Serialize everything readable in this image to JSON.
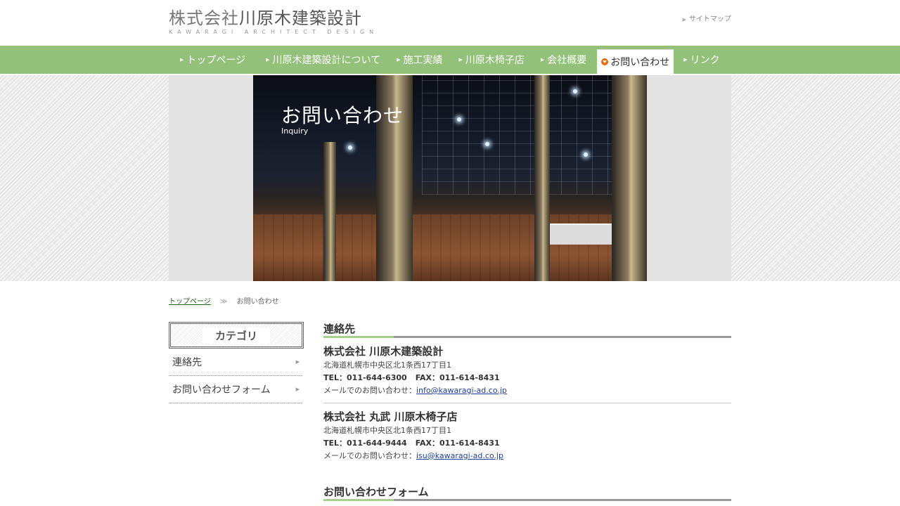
{
  "header": {
    "logo_light": "株式会社",
    "logo_dark": "川原木建築設計",
    "logo_sub": "KAWARAGI ARCHITECT DESIGN",
    "sitemap": "サイトマップ"
  },
  "nav": {
    "items": [
      {
        "label": "トップページ"
      },
      {
        "label": "川原木建築設計について"
      },
      {
        "label": "施工実績"
      },
      {
        "label": "川原木椅子店"
      },
      {
        "label": "会社概要"
      },
      {
        "label": "お問い合わせ"
      },
      {
        "label": "リンク"
      }
    ],
    "active_index": 5
  },
  "hero": {
    "title": "お問い合わせ",
    "subtitle": "Inquiry"
  },
  "breadcrumb": {
    "home": "トップページ",
    "sep": "≫",
    "current": "お問い合わせ"
  },
  "sidebar": {
    "title": "カテゴリ",
    "items": [
      {
        "label": "連絡先"
      },
      {
        "label": "お問い合わせフォーム"
      }
    ]
  },
  "main": {
    "section1_title": "連絡先",
    "contacts": [
      {
        "name": "株式会社 川原木建築設計",
        "address": "北海道札幌市中央区北1条西17丁目1",
        "tel": "TEL：011-644-6300",
        "fax": "FAX：011-614-8431",
        "mail_label": "メールでのお問い合わせ：",
        "email": "info@kawaragi-ad.co.jp"
      },
      {
        "name": "株式会社 丸武 川原木椅子店",
        "address": "北海道札幌市中央区北1条西17丁目1",
        "tel": "TEL：011-644-9444",
        "fax": "FAX：011-614-8431",
        "mail_label": "メールでのお問い合わせ：",
        "email": "isu@kawaragi-ad.co.jp"
      }
    ],
    "section2_title": "お問い合わせフォーム"
  },
  "colors": {
    "nav_green": "#93c17a",
    "accent_orange": "#e96a0c",
    "link_blue": "#1f3f9c"
  }
}
